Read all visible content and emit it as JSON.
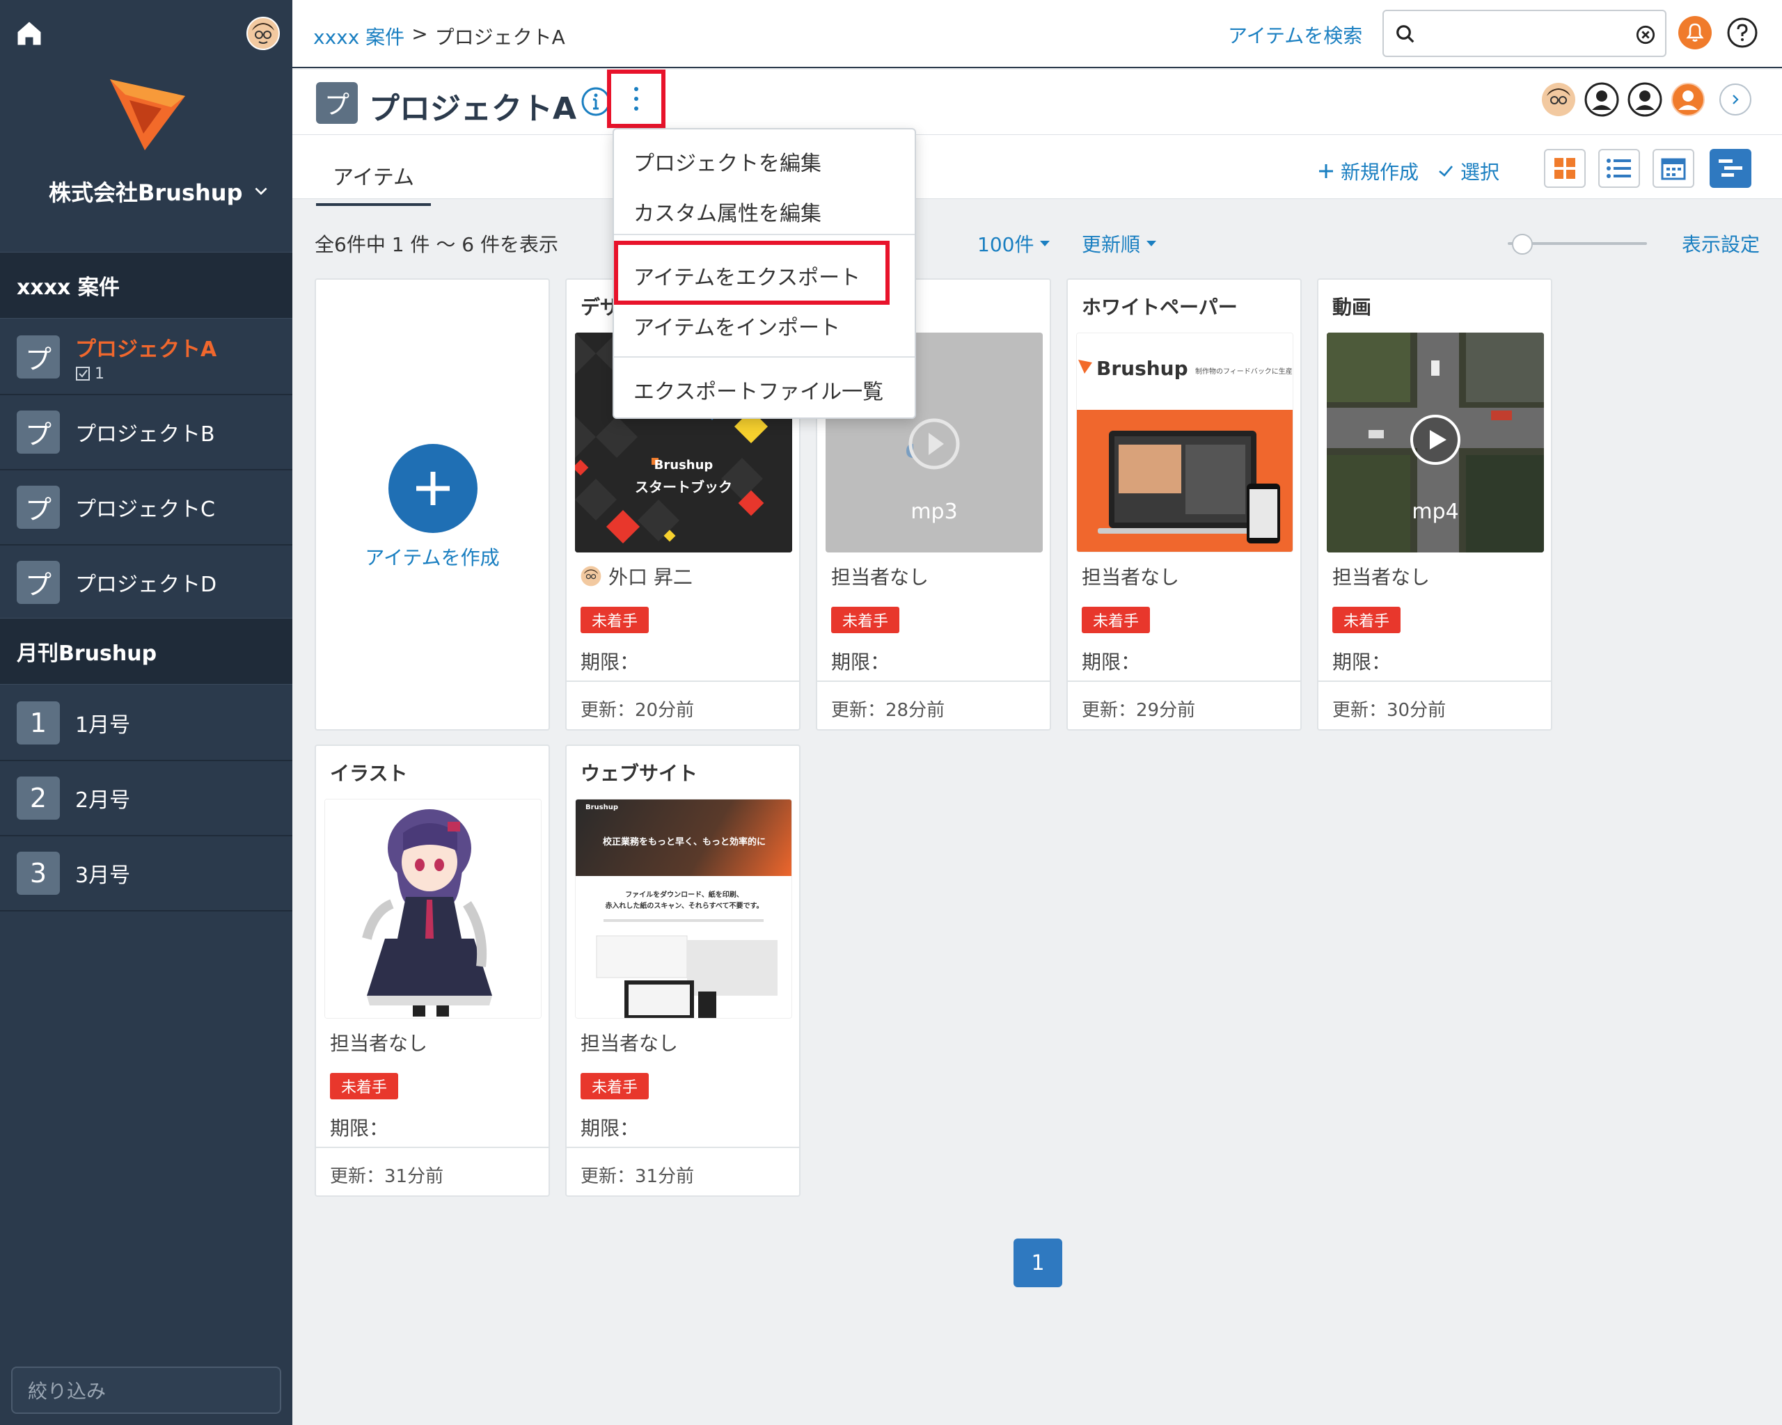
{
  "sidebar": {
    "company": "株式会社Brushup",
    "sections": [
      {
        "label": "xxxx 案件",
        "projects": [
          {
            "glyph": "プ",
            "label": "プロジェクトA",
            "count": "1",
            "active": true
          },
          {
            "glyph": "プ",
            "label": "プロジェクトB"
          },
          {
            "glyph": "プ",
            "label": "プロジェクトC"
          },
          {
            "glyph": "プ",
            "label": "プロジェクトD"
          }
        ]
      },
      {
        "label": "月刊Brushup",
        "projects": [
          {
            "glyph": "1",
            "label": "1月号"
          },
          {
            "glyph": "2",
            "label": "2月号"
          },
          {
            "glyph": "3",
            "label": "3月号"
          }
        ]
      }
    ],
    "filter_placeholder": "絞り込み"
  },
  "topbar": {
    "breadcrumb_link": "xxxx 案件",
    "breadcrumb_sep": ">",
    "breadcrumb_current": "プロジェクトA",
    "search_label": "アイテムを検索",
    "search_value": ""
  },
  "project": {
    "glyph": "プ",
    "title": "プロジェクトA"
  },
  "tabs": {
    "active": "アイテム",
    "new_label": "新規作成",
    "select_label": "選択"
  },
  "filters": {
    "count_text": "全6件中 1 件 〜 6 件を表示",
    "per_page": "100件",
    "sort": "更新順",
    "display_settings": "表示設定"
  },
  "menu": {
    "items": [
      "プロジェクトを編集",
      "カスタム属性を編集",
      "アイテムをエクスポート",
      "アイテムをインポート",
      "エクスポートファイル一覧"
    ]
  },
  "create_label": "アイテムを作成",
  "cards": [
    {
      "title": "デザ",
      "assignee": "外口 昇二",
      "status": "未着手",
      "due": "期限：",
      "updated": "更新：20分前",
      "thumb_text": "スタートブック",
      "thumb_brand": "Brushup"
    },
    {
      "title": "",
      "assignee": "担当者なし",
      "status": "未着手",
      "due": "期限：",
      "updated": "更新：28分前",
      "thumb_text": "mp3"
    },
    {
      "title": "ホワイトペーパー",
      "assignee": "担当者なし",
      "status": "未着手",
      "due": "期限：",
      "updated": "更新：29分前",
      "thumb_brand": "Brushup",
      "thumb_tagline": "制作物のフィードバックに生産"
    },
    {
      "title": "動画",
      "assignee": "担当者なし",
      "status": "未着手",
      "due": "期限：",
      "updated": "更新：30分前",
      "thumb_text": "mp4"
    },
    {
      "title": "イラスト",
      "assignee": "担当者なし",
      "status": "未着手",
      "due": "期限：",
      "updated": "更新：31分前"
    },
    {
      "title": "ウェブサイト",
      "assignee": "担当者なし",
      "status": "未着手",
      "due": "期限：",
      "updated": "更新：31分前",
      "thumb_brand": "Brushup",
      "thumb_headline": "校正業務をもっと早く、もっと効率的に",
      "thumb_sub1": "ファイルをダウンロード、紙を印刷、",
      "thumb_sub2": "赤入れした紙のスキャン、それらすべて不要です。"
    }
  ],
  "pagination": {
    "current": "1"
  },
  "colors": {
    "sidebar_bg": "#2b3a4c",
    "accent_blue": "#1a7fc1",
    "active_orange": "#f0672d",
    "badge_red": "#e8372c",
    "highlight_red": "#e8132b"
  }
}
